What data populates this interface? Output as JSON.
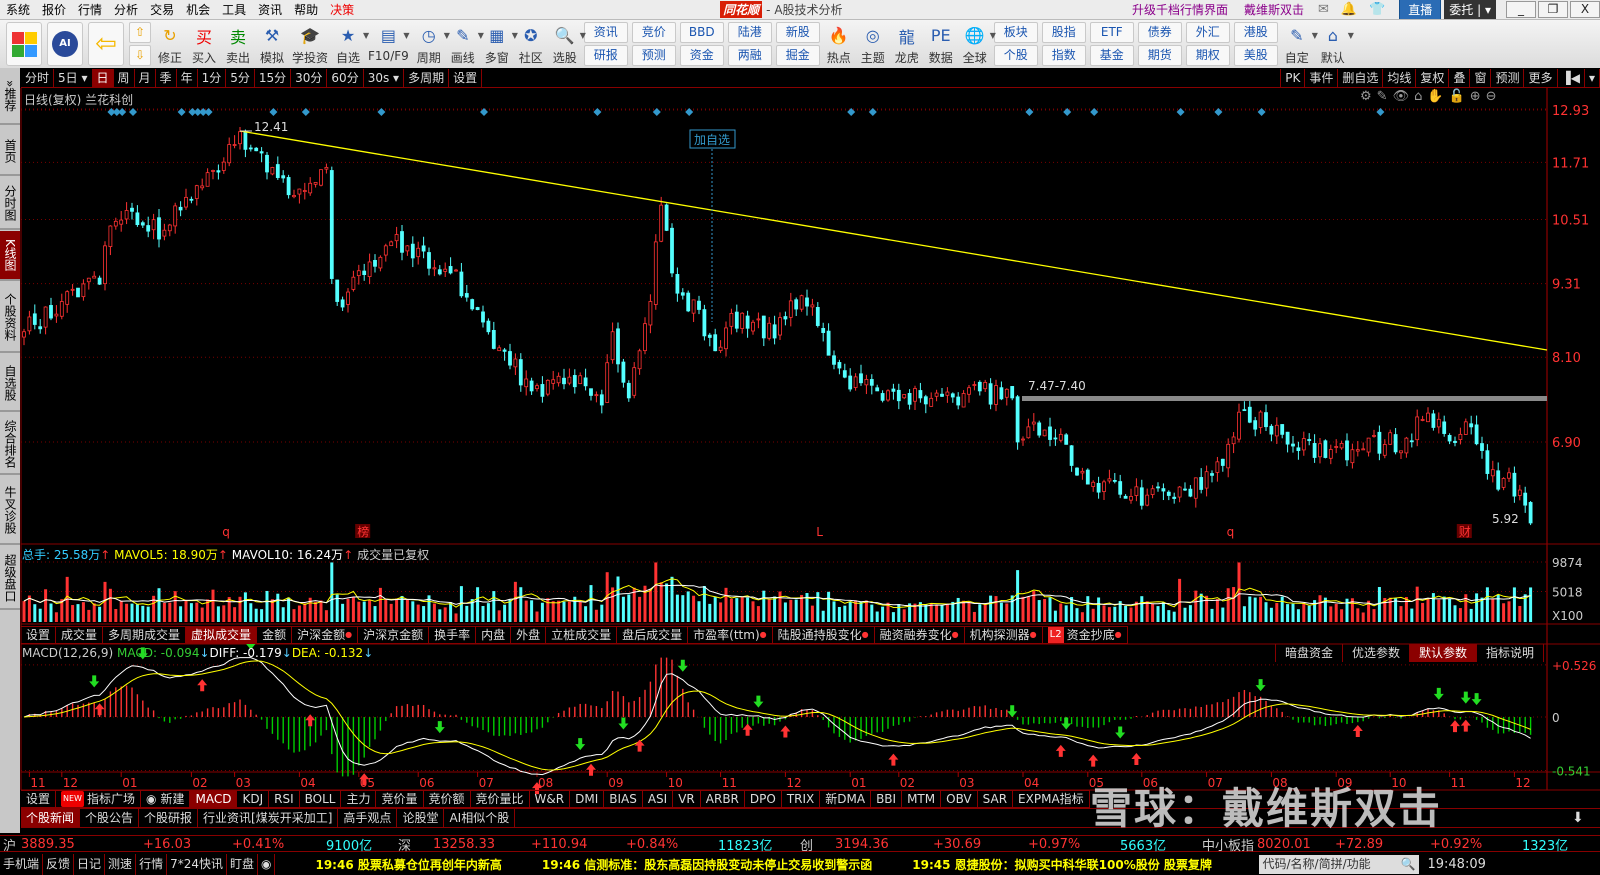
{
  "menubar": {
    "items": [
      "系统",
      "报价",
      "行情",
      "分析",
      "交易",
      "机会",
      "工具",
      "资讯",
      "帮助"
    ],
    "highlight": "决策",
    "logo": "同花顺",
    "title": "- A股技术分析",
    "upgrade": "升级千档行情界面",
    "user": "戴维斯双击",
    "live": "直播",
    "entrust": "委托",
    "win": [
      "_",
      "❐",
      "X"
    ]
  },
  "toolbar": {
    "single": [
      "修正",
      "买入",
      "卖出",
      "模拟",
      "学投资",
      "自选",
      "F10/F9",
      "周期",
      "画线",
      "多窗",
      "社区",
      "选股"
    ],
    "pairs1": [
      [
        "资讯",
        "研报"
      ],
      [
        "竞价",
        "预测"
      ],
      [
        "BBD",
        "资金"
      ],
      [
        "陆港",
        "两融"
      ],
      [
        "新股",
        "掘金"
      ]
    ],
    "single2": [
      "热点",
      "主题",
      "龙虎",
      "数据",
      "全球"
    ],
    "pairs2": [
      [
        "板块",
        "个股"
      ],
      [
        "股指",
        "指数"
      ],
      [
        "ETF",
        "基金"
      ],
      [
        "债券",
        "期货"
      ],
      [
        "外汇",
        "期权"
      ],
      [
        "港股",
        "美股"
      ]
    ],
    "single3": [
      "自定",
      "默认"
    ],
    "ai": "AI"
  },
  "sidebar": [
    {
      "label": "»推荐"
    },
    {
      "label": "首页"
    },
    {
      "label": "分时图"
    },
    {
      "label": "K线图",
      "active": true
    },
    {
      "label": "个股资料"
    },
    {
      "label": "自选股"
    },
    {
      "label": "综合排名"
    },
    {
      "label": "牛叉诊股"
    },
    {
      "label": "超级盘口"
    }
  ],
  "periodbar": {
    "items": [
      "分时",
      "5日 ▾",
      "日",
      "周",
      "月",
      "季",
      "年",
      "1分",
      "5分",
      "15分",
      "30分",
      "60分",
      "30s ▾",
      "多周期",
      "设置"
    ],
    "active": "日",
    "right": [
      "PK",
      "事件",
      "删自选",
      "均线",
      "复权",
      "叠",
      "窗",
      "预测",
      "更多",
      "▐◀",
      "▾"
    ]
  },
  "chart": {
    "header": "日线(复权)  兰花科创",
    "tools": [
      "⚙",
      "✎",
      "👁",
      "⌂",
      "✋",
      "🔓",
      "⊕",
      "⊖"
    ],
    "peak_label": "12.41",
    "range_label": "7.47-7.40",
    "last_label": "5.92",
    "add_fav": "加自选",
    "markers": [
      {
        "text": "q",
        "i": 33
      },
      {
        "text": "榜",
        "i": 58
      },
      {
        "text": "L",
        "i": 143
      },
      {
        "text": "q",
        "i": 219
      },
      {
        "text": "财",
        "i": 262
      }
    ]
  },
  "chart_data": {
    "type": "candlestick",
    "title": "日线(复权) 兰花科创",
    "yaxis_ticks": [
      12.93,
      11.71,
      10.51,
      9.31,
      8.1,
      6.9
    ],
    "y_scale": "log",
    "candle_count": 280,
    "close_anchors": [
      [
        0,
        8.5
      ],
      [
        7,
        9.0
      ],
      [
        14,
        9.3
      ],
      [
        15,
        10.0
      ],
      [
        18,
        10.5
      ],
      [
        26,
        10.3
      ],
      [
        33,
        11.2
      ],
      [
        40,
        12.41
      ],
      [
        45,
        11.5
      ],
      [
        50,
        11.0
      ],
      [
        56,
        11.6
      ],
      [
        57,
        9.4
      ],
      [
        58,
        9.0
      ],
      [
        67,
        10.0
      ],
      [
        71,
        10.0
      ],
      [
        79,
        9.5
      ],
      [
        86,
        8.5
      ],
      [
        94,
        7.6
      ],
      [
        101,
        7.8
      ],
      [
        107,
        7.4
      ],
      [
        109,
        8.5
      ],
      [
        112,
        7.5
      ],
      [
        116,
        9.0
      ],
      [
        118,
        10.8
      ],
      [
        120,
        9.5
      ],
      [
        128,
        8.2
      ],
      [
        131,
        8.8
      ],
      [
        139,
        8.4
      ],
      [
        144,
        9.1
      ],
      [
        147,
        8.6
      ],
      [
        152,
        7.8
      ],
      [
        158,
        7.6
      ],
      [
        166,
        7.5
      ],
      [
        173,
        7.4
      ],
      [
        177,
        7.6
      ],
      [
        183,
        7.5
      ],
      [
        184,
        6.9
      ],
      [
        186,
        7.1
      ],
      [
        192,
        7.0
      ],
      [
        194,
        6.6
      ],
      [
        203,
        6.25
      ],
      [
        213,
        6.2
      ],
      [
        222,
        6.6
      ],
      [
        225,
        7.3
      ],
      [
        233,
        7.0
      ],
      [
        241,
        6.7
      ],
      [
        247,
        6.8
      ],
      [
        256,
        6.95
      ],
      [
        259,
        7.2
      ],
      [
        266,
        7.0
      ],
      [
        268,
        7.1
      ],
      [
        271,
        6.5
      ],
      [
        277,
        6.3
      ],
      [
        279,
        5.92
      ]
    ],
    "months": [
      [
        1,
        "11"
      ],
      [
        7,
        "12"
      ],
      [
        18,
        "01"
      ],
      [
        31,
        "02"
      ],
      [
        39,
        "03"
      ],
      [
        51,
        "04"
      ],
      [
        62,
        "05"
      ],
      [
        73,
        "06"
      ],
      [
        84,
        "07"
      ],
      [
        95,
        "08"
      ],
      [
        108,
        "09"
      ],
      [
        119,
        "10"
      ],
      [
        129,
        "11"
      ],
      [
        141,
        "12"
      ],
      [
        153,
        "01"
      ],
      [
        162,
        "02"
      ],
      [
        173,
        "03"
      ],
      [
        185,
        "04"
      ],
      [
        197,
        "05"
      ],
      [
        207,
        "06"
      ],
      [
        219,
        "07"
      ],
      [
        231,
        "08"
      ],
      [
        243,
        "09"
      ],
      [
        253,
        "10"
      ],
      [
        264,
        "11"
      ],
      [
        276,
        "12"
      ]
    ],
    "event_diamonds": [
      11,
      12,
      13,
      15,
      24,
      26,
      27,
      28,
      29,
      41,
      47,
      61,
      80,
      101,
      112,
      118,
      148,
      152,
      181,
      188,
      193,
      209,
      216,
      224,
      246
    ],
    "volume": {
      "ticks": [
        "9874",
        "5018",
        "X100"
      ],
      "tick_values": [
        9874,
        5018
      ]
    },
    "macd": {
      "ticks": [
        "+0.526",
        "0",
        "-0.541"
      ],
      "tick_values": [
        0.526,
        0,
        -0.541
      ],
      "params": [
        12,
        26,
        9
      ],
      "buy_signals": [
        14,
        33,
        53,
        63,
        95,
        105,
        114,
        134,
        141,
        161,
        192,
        198,
        206,
        247,
        265,
        267
      ],
      "sell_signals": [
        13,
        22,
        42,
        77,
        103,
        111,
        122,
        136,
        183,
        193,
        203,
        229,
        262,
        267,
        269
      ]
    },
    "colors": {
      "up": "#ff3232",
      "down": "#54ffff",
      "trend": "#ffff00",
      "diff": "#ffffff",
      "dea": "#ffff00"
    }
  },
  "volume": {
    "total": "总手: 25.58万",
    "mavol5": "MAVOL5: 18.90万",
    "mavol10": "MAVOL10: 16.24万",
    "note": "成交量已复权",
    "tabs": [
      {
        "t": "设置"
      },
      {
        "t": "成交量"
      },
      {
        "t": "多周期成交量"
      },
      {
        "t": "虚拟成交量",
        "act": true
      },
      {
        "t": "金额"
      },
      {
        "t": "沪深金额",
        "star": true
      },
      {
        "t": "沪深京金额"
      },
      {
        "t": "换手率"
      },
      {
        "t": "内盘"
      },
      {
        "t": "外盘"
      },
      {
        "t": "立桩成交量"
      },
      {
        "t": "盘后成交量"
      },
      {
        "t": "市盈率(ttm)",
        "star": true
      },
      {
        "t": "陆股通持股变化",
        "star": true
      },
      {
        "t": "融资融券变化",
        "star": true
      },
      {
        "t": "机构探测器",
        "star": true
      },
      {
        "t": "资金抄底",
        "star": true,
        "l2": "L2"
      }
    ]
  },
  "macd": {
    "title": "MACD(12,26,9)",
    "macd": "MACD: -0.094",
    "diff": "DIFF: -0.179",
    "dea": "DEA: -0.132",
    "buttons": [
      "暗盘资金",
      "优选参数",
      "默认参数",
      "指标说明"
    ],
    "active_button": "默认参数"
  },
  "indicator_tabs": [
    {
      "t": "设置"
    },
    {
      "t": "指标广场",
      "badge": "NEW"
    },
    {
      "t": "新建",
      "icon": true
    },
    {
      "t": "MACD",
      "act": true
    },
    {
      "t": "KDJ"
    },
    {
      "t": "RSI"
    },
    {
      "t": "BOLL"
    },
    {
      "t": "主力"
    },
    {
      "t": "竞价量"
    },
    {
      "t": "竞价额"
    },
    {
      "t": "竞价量比"
    },
    {
      "t": "W&R"
    },
    {
      "t": "DMI"
    },
    {
      "t": "BIAS"
    },
    {
      "t": "ASI"
    },
    {
      "t": "VR"
    },
    {
      "t": "ARBR"
    },
    {
      "t": "DPO"
    },
    {
      "t": "TRIX"
    },
    {
      "t": "新DMA"
    },
    {
      "t": "BBI"
    },
    {
      "t": "MTM"
    },
    {
      "t": "OBV"
    },
    {
      "t": "SAR"
    },
    {
      "t": "EXPMA指标"
    }
  ],
  "news_tabs": [
    {
      "t": "个股新闻",
      "act": true
    },
    {
      "t": "个股公告"
    },
    {
      "t": "个股研报"
    },
    {
      "t": "行业资讯[煤炭开采加工]"
    },
    {
      "t": "高手观点"
    },
    {
      "t": "论股堂"
    },
    {
      "t": "AI相似个股"
    }
  ],
  "watermark": "雪球：戴维斯双击",
  "indices": [
    {
      "name": "沪",
      "value": "3889.35",
      "change": "+16.03",
      "pct": "+0.41%",
      "amount": "9100亿"
    },
    {
      "name": "深",
      "value": "13258.33",
      "change": "+110.94",
      "pct": "+0.84%",
      "amount": "11823亿"
    },
    {
      "name": "创",
      "value": "3194.36",
      "change": "+30.69",
      "pct": "+0.97%",
      "amount": "5663亿"
    },
    {
      "name": "中小板指",
      "value": "8020.01",
      "change": "+72.89",
      "pct": "+0.92%",
      "amount": "1323亿"
    }
  ],
  "statusbar": {
    "items": [
      "手机端",
      "反馈",
      "日记",
      "测速",
      "行情",
      "7*24快讯",
      "盯盘"
    ],
    "ticker": [
      "19:46 股票私募仓位再创年内新高",
      "19:46 信测标准：股东高磊因持股变动未停止交易收到警示函",
      "19:45 恩捷股份：拟购买中科华联100%股份 股票复牌"
    ],
    "search_placeholder": "代码/名称/简拼/功能",
    "time": "19:48:09"
  }
}
